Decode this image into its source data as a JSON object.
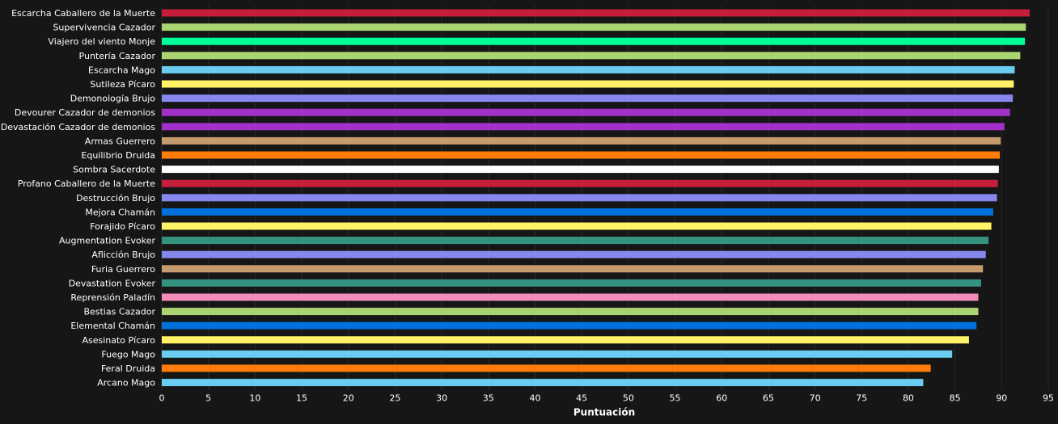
{
  "chart_data": {
    "type": "bar",
    "orientation": "horizontal",
    "xlabel": "Puntuación",
    "xlim": [
      0,
      95
    ],
    "xticks": [
      0,
      5,
      10,
      15,
      20,
      25,
      30,
      35,
      40,
      45,
      50,
      55,
      60,
      65,
      70,
      75,
      80,
      85,
      90,
      95
    ],
    "grid": true,
    "categories": [
      "Escarcha Caballero de la Muerte",
      "Supervivencia Cazador",
      "Viajero del viento Monje",
      "Puntería Cazador",
      "Escarcha Mago",
      "Sutileza Pícaro",
      "Demonología Brujo",
      "Devourer Cazador de demonios",
      "Devastación Cazador de demonios",
      "Armas Guerrero",
      "Equilibrio Druida",
      "Sombra Sacerdote",
      "Profano Caballero de la Muerte",
      "Destrucción Brujo",
      "Mejora Chamán",
      "Forajido Pícaro",
      "Augmentation Evoker",
      "Aflicción Brujo",
      "Furia Guerrero",
      "Devastation Evoker",
      "Reprensión Paladín",
      "Bestias Cazador",
      "Elemental Chamán",
      "Asesinato Pícaro",
      "Fuego Mago",
      "Feral Druida",
      "Arcano Mago"
    ],
    "values": [
      93.0,
      92.6,
      92.5,
      92.0,
      91.4,
      91.3,
      91.2,
      90.9,
      90.3,
      89.9,
      89.8,
      89.7,
      89.6,
      89.5,
      89.1,
      88.9,
      88.6,
      88.3,
      88.0,
      87.8,
      87.5,
      87.5,
      87.3,
      86.5,
      84.7,
      82.4,
      81.6
    ],
    "colors": [
      "#c41e3a",
      "#aad372",
      "#00ff98",
      "#aad372",
      "#69ccf0",
      "#fff468",
      "#8788ee",
      "#a330c9",
      "#a330c9",
      "#c69b6d",
      "#ff7c0a",
      "#ffffff",
      "#c41e3a",
      "#8788ee",
      "#0070dd",
      "#fff468",
      "#33937f",
      "#8788ee",
      "#c69b6d",
      "#33937f",
      "#f48cba",
      "#aad372",
      "#0070dd",
      "#fff468",
      "#69ccf0",
      "#ff7c0a",
      "#69ccf0"
    ]
  }
}
